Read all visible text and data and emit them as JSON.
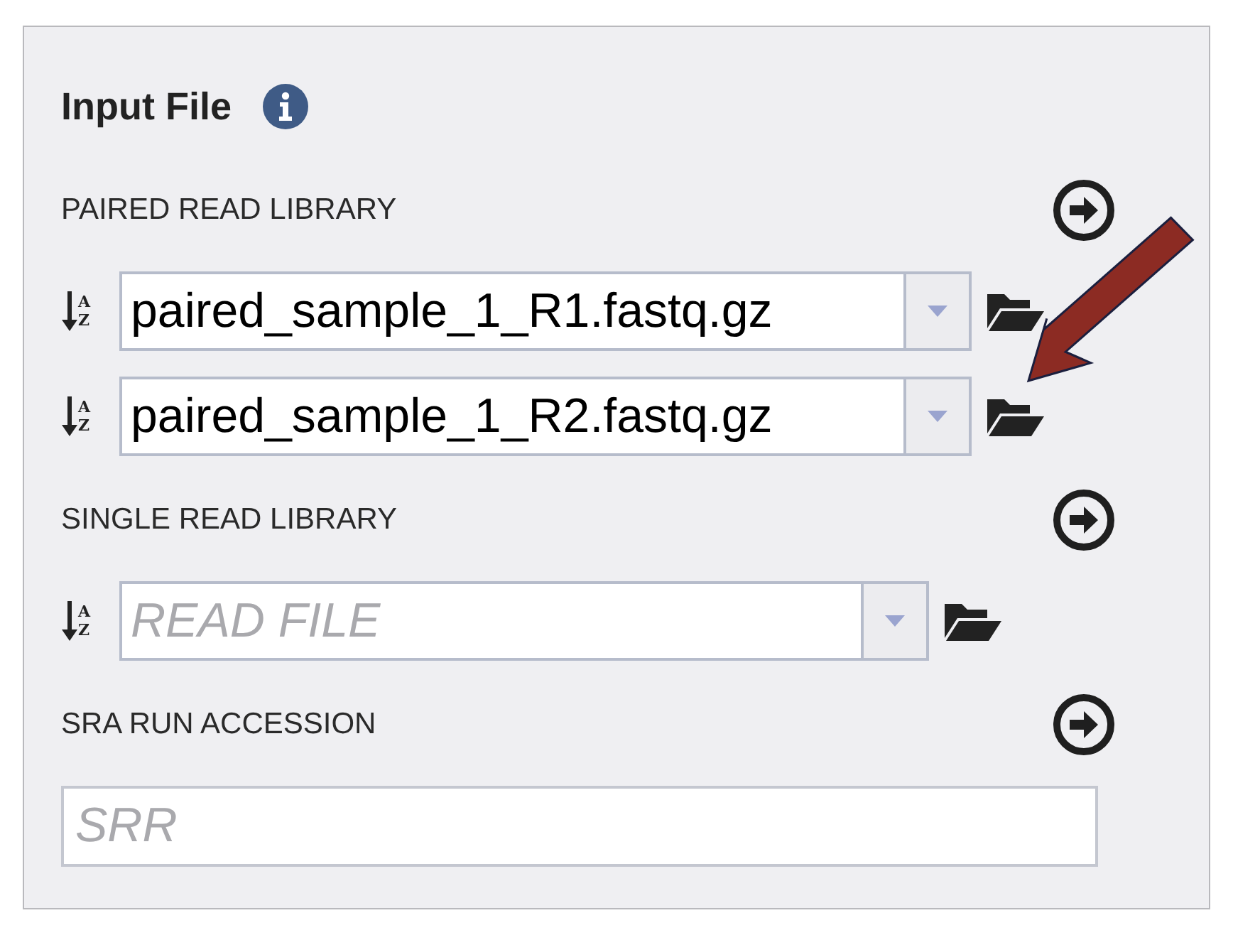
{
  "title": "Input File",
  "sections": [
    {
      "kind": "paired",
      "label": "PAIRED READ LIBRARY",
      "fields": [
        {
          "sort": [
            "A",
            "Z"
          ],
          "value": "paired_sample_1_R1.fastq.gz"
        },
        {
          "sort": [
            "A",
            "Z"
          ],
          "value": "paired_sample_1_R2.fastq.gz"
        }
      ]
    },
    {
      "kind": "single",
      "label": "SINGLE READ LIBRARY",
      "fields": [
        {
          "sort": [
            "A",
            "Z"
          ],
          "placeholder": "READ FILE"
        }
      ]
    },
    {
      "kind": "accession",
      "label": "SRA RUN ACCESSION",
      "placeholder": "SRR"
    }
  ]
}
